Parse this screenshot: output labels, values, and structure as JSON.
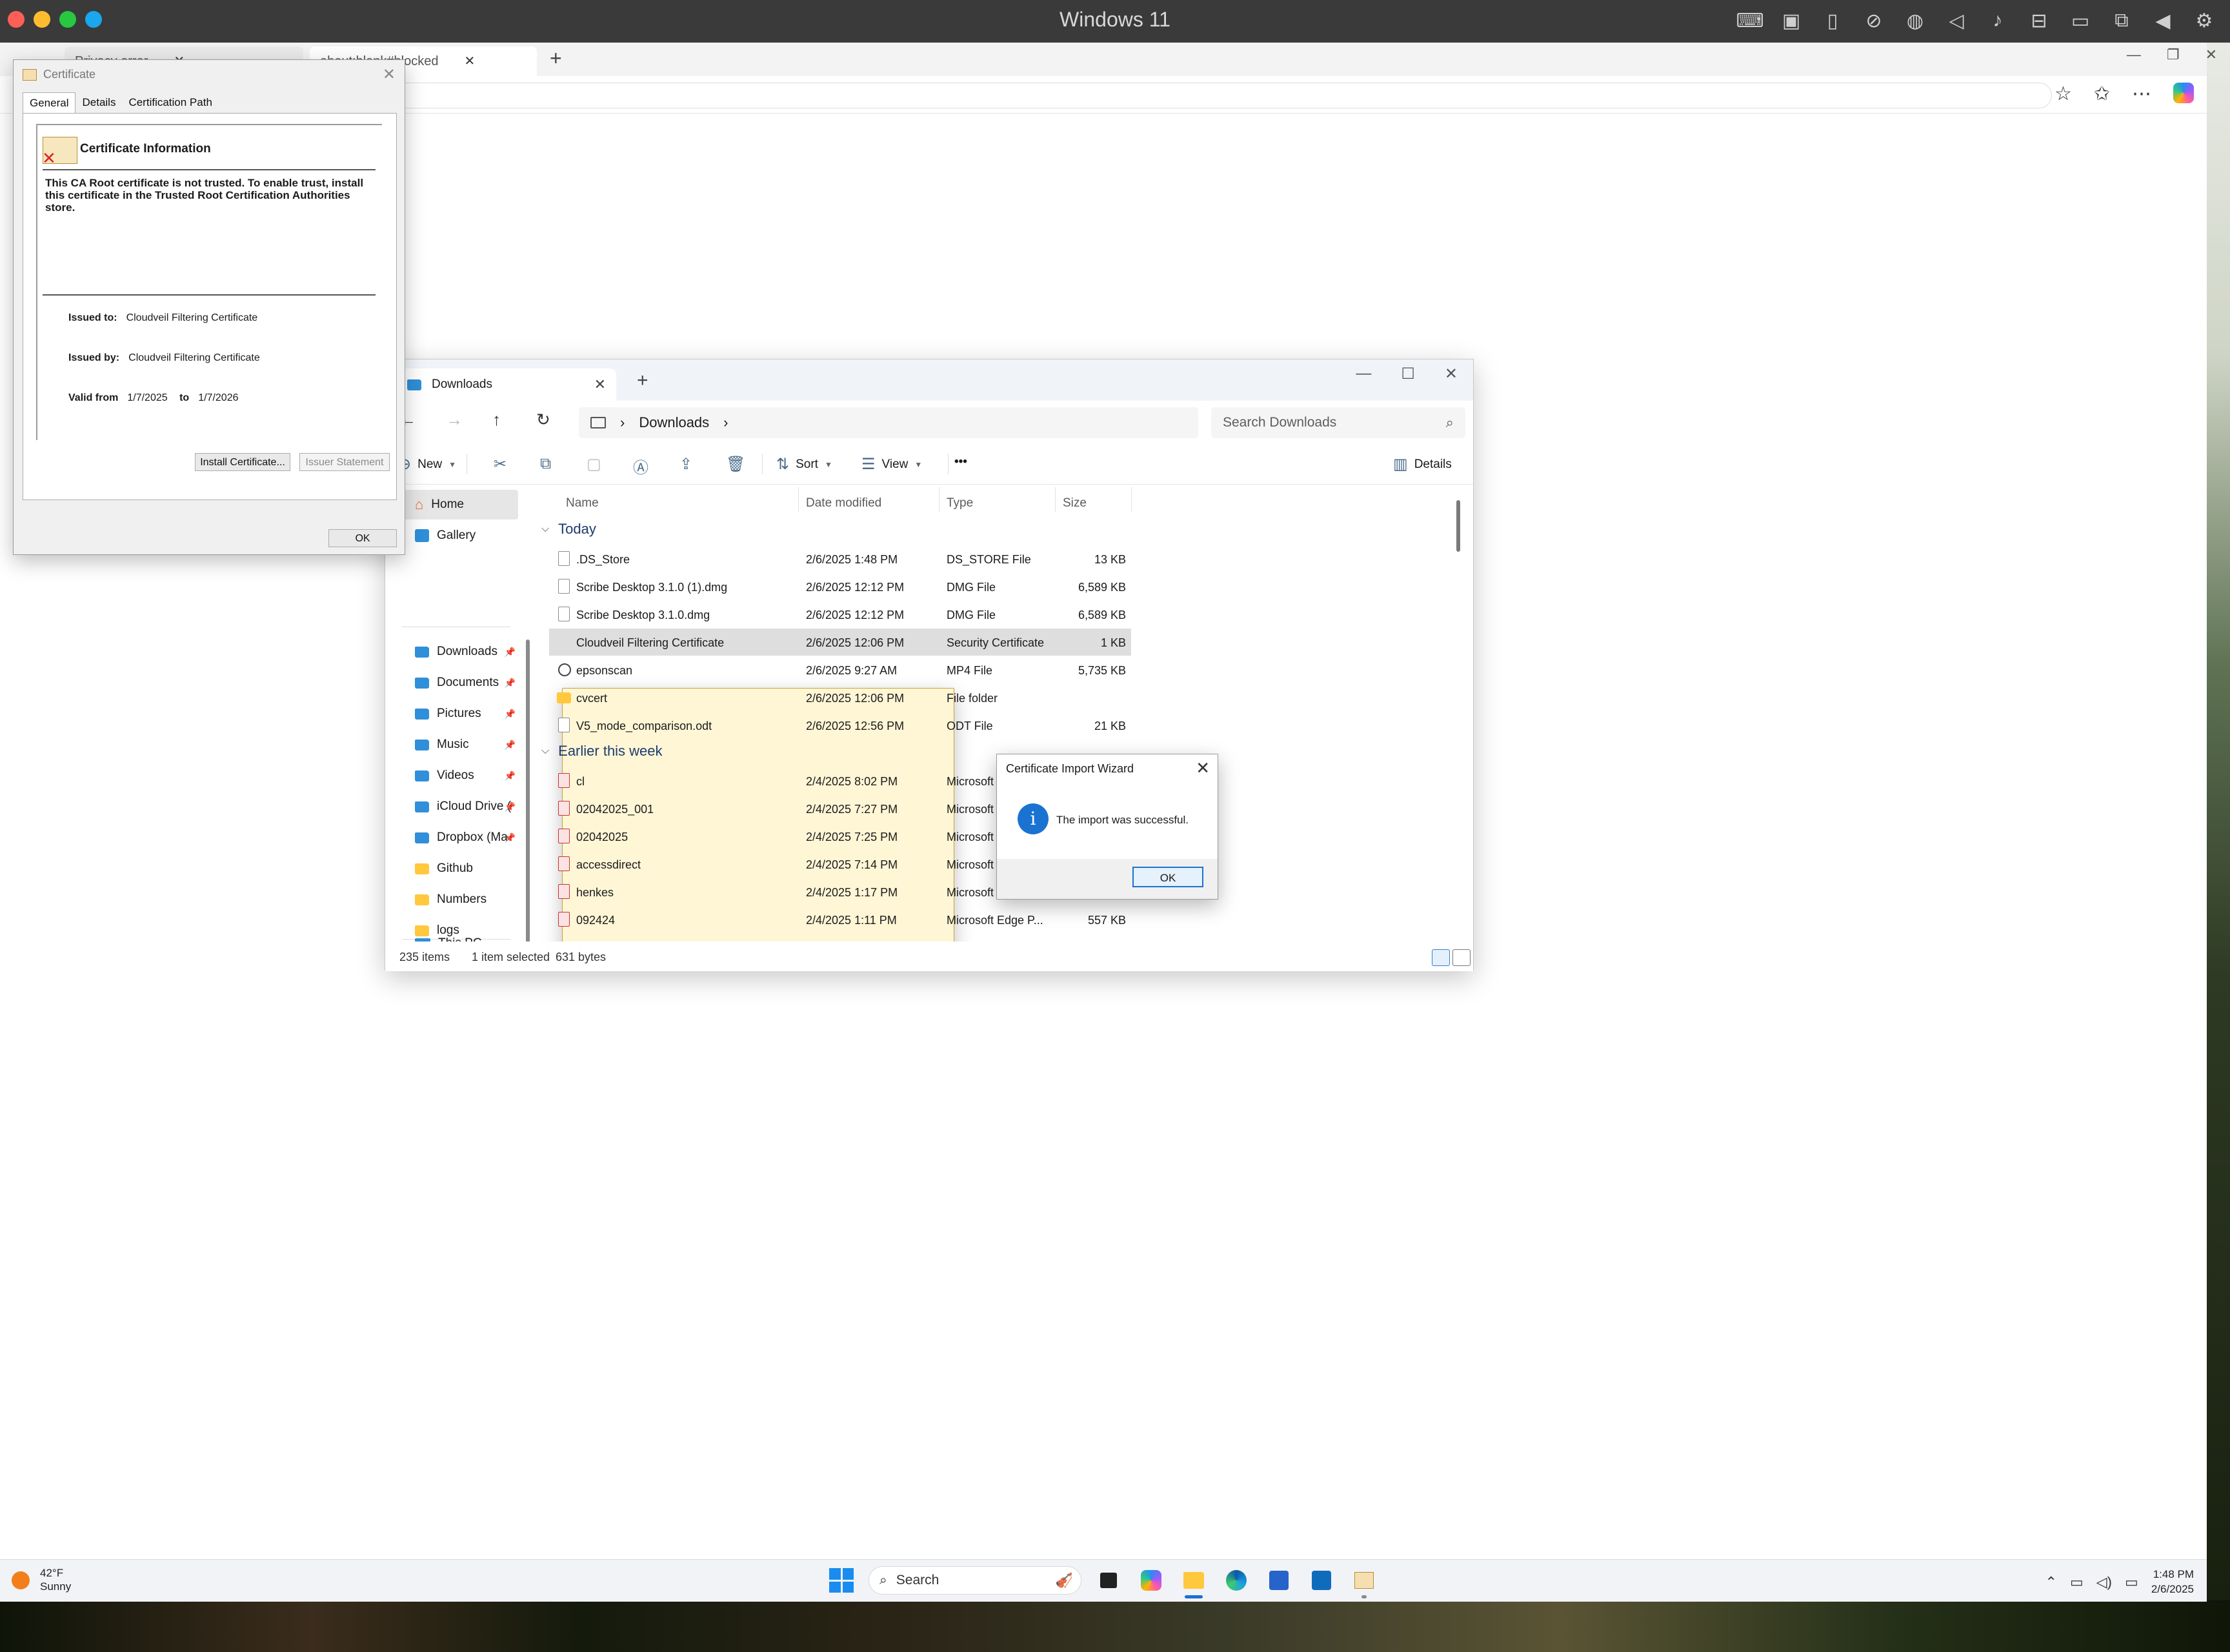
{
  "vm": {
    "title": "Windows 11",
    "toolbar_icons": [
      "keyboard-icon",
      "cpu-icon",
      "usb-icon",
      "camera-off-icon",
      "globe-icon",
      "volume-icon",
      "microphone-icon",
      "drive-icon",
      "video-icon",
      "screenshot-icon",
      "back-icon",
      "gear-icon"
    ]
  },
  "browser": {
    "tabs": [
      "Privacy error",
      "about:blank#blocked"
    ],
    "new_tab": "+"
  },
  "certificate_dialog": {
    "title": "Certificate",
    "tabs": [
      "General",
      "Details",
      "Certification Path"
    ],
    "heading": "Certificate Information",
    "message": "This CA Root certificate is not trusted. To enable trust, install this certificate in the Trusted Root Certification Authorities store.",
    "issued_to_label": "Issued to:",
    "issued_to": "Cloudveil Filtering Certificate",
    "issued_by_label": "Issued by:",
    "issued_by": "Cloudveil Filtering Certificate",
    "valid_from_label": "Valid from",
    "valid_from": "1/7/2025",
    "valid_to_label": "to",
    "valid_to": "1/7/2026",
    "install_button": "Install Certificate...",
    "issuer_statement_button": "Issuer Statement",
    "ok_button": "OK"
  },
  "explorer": {
    "tab_title": "Downloads",
    "breadcrumb": "Downloads",
    "search_placeholder": "Search Downloads",
    "toolbar": {
      "new": "New",
      "sort": "Sort",
      "view": "View",
      "more": "•••",
      "details": "Details"
    },
    "nav": {
      "home": "Home",
      "gallery": "Gallery",
      "pinned": [
        "Downloads",
        "Documents",
        "Pictures",
        "Music",
        "Videos",
        "iCloud Drive (",
        "Dropbox (Ma",
        "Github",
        "Numbers",
        "logs"
      ],
      "this_pc": "This PC"
    },
    "columns": {
      "name": "Name",
      "date": "Date modified",
      "type": "Type",
      "size": "Size"
    },
    "groups": {
      "today": "Today",
      "earlier": "Earlier this week"
    },
    "today_files": [
      {
        "name": ".DS_Store",
        "date": "2/6/2025 1:48 PM",
        "type": "DS_STORE File",
        "size": "13 KB",
        "icon": "file"
      },
      {
        "name": "Scribe Desktop 3.1.0 (1).dmg",
        "date": "2/6/2025 12:12 PM",
        "type": "DMG File",
        "size": "6,589 KB",
        "icon": "file"
      },
      {
        "name": "Scribe Desktop 3.1.0.dmg",
        "date": "2/6/2025 12:12 PM",
        "type": "DMG File",
        "size": "6,589 KB",
        "icon": "file"
      },
      {
        "name": "Cloudveil Filtering Certificate",
        "date": "2/6/2025 12:06 PM",
        "type": "Security Certificate",
        "size": "1 KB",
        "icon": "cert"
      },
      {
        "name": "epsonscan",
        "date": "2/6/2025 9:27 AM",
        "type": "MP4 File",
        "size": "5,735 KB",
        "icon": "media"
      },
      {
        "name": "cvcert",
        "date": "2/6/2025 12:06 PM",
        "type": "File folder",
        "size": "",
        "icon": "folder"
      },
      {
        "name": "V5_mode_comparison.odt",
        "date": "2/6/2025 12:56 PM",
        "type": "ODT File",
        "size": "21 KB",
        "icon": "file"
      }
    ],
    "earlier_files": [
      {
        "name": "cl",
        "date": "2/4/2025 8:02 PM",
        "type": "Microsoft",
        "size": "",
        "icon": "pdf"
      },
      {
        "name": "02042025_001",
        "date": "2/4/2025 7:27 PM",
        "type": "Microsoft",
        "size": "",
        "icon": "pdf"
      },
      {
        "name": "02042025",
        "date": "2/4/2025 7:25 PM",
        "type": "Microsoft",
        "size": "",
        "icon": "pdf"
      },
      {
        "name": "accessdirect",
        "date": "2/4/2025 7:14 PM",
        "type": "Microsoft",
        "size": "",
        "icon": "pdf"
      },
      {
        "name": "henkes",
        "date": "2/4/2025 1:17 PM",
        "type": "Microsoft",
        "size": "",
        "icon": "pdf"
      },
      {
        "name": "092424",
        "date": "2/4/2025 1:11 PM",
        "type": "Microsoft Edge P...",
        "size": "557 KB",
        "icon": "pdf"
      }
    ],
    "status": {
      "count": "235 items",
      "selected": "1 item selected",
      "bytes": "631 bytes"
    }
  },
  "import_wizard": {
    "title": "Certificate Import Wizard",
    "message": "The import was successful.",
    "ok_button": "OK"
  },
  "taskbar": {
    "temperature": "42°F",
    "condition": "Sunny",
    "search_label": "Search",
    "time": "1:48 PM",
    "date": "2/6/2025"
  },
  "colors": {
    "accent": "#1a73d1",
    "titlebar": "#3a3a3a",
    "group_heading": "#1d3c6e",
    "selection": "#dedede"
  }
}
